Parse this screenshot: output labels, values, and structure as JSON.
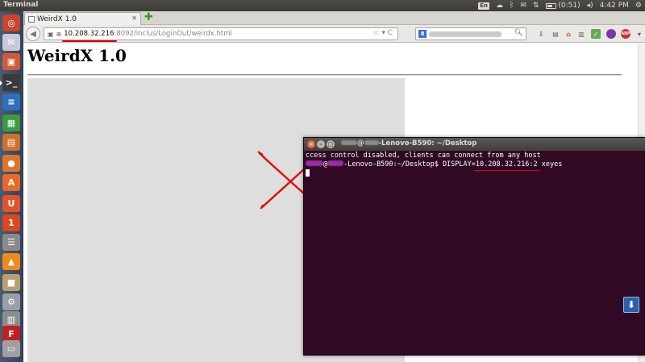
{
  "top_panel": {
    "app_title": "Terminal",
    "keyboard_layout": "En",
    "battery_time": "(0:51)",
    "clock": "4:42 PM"
  },
  "launcher": {
    "items": [
      {
        "name": "dash-home",
        "glyph": "◎",
        "color": "#c7462c"
      },
      {
        "name": "pidgin",
        "glyph": "✉",
        "color": "#c8c8d8"
      },
      {
        "name": "media-player",
        "glyph": "▣",
        "color": "#d05a3a"
      },
      {
        "name": "terminal",
        "glyph": ">_",
        "color": "#3a3a3a"
      },
      {
        "name": "libreoffice-writer",
        "glyph": "≡",
        "color": "#2f6fbf"
      },
      {
        "name": "libreoffice-calc",
        "glyph": "▦",
        "color": "#3e9a3e"
      },
      {
        "name": "libreoffice-impress",
        "glyph": "▤",
        "color": "#d0702a"
      },
      {
        "name": "firefox",
        "glyph": "●",
        "color": "#e0752a"
      },
      {
        "name": "software-center",
        "glyph": "A",
        "color": "#e8692a"
      },
      {
        "name": "ubuntu-one",
        "glyph": "U",
        "color": "#e0542a"
      },
      {
        "name": "ubuntu-one-2",
        "glyph": "1",
        "color": "#d9481f"
      },
      {
        "name": "notes-app",
        "glyph": "☰",
        "color": "#8a8a8a"
      },
      {
        "name": "vlc",
        "glyph": "▲",
        "color": "#f08a1a"
      },
      {
        "name": "archive-manager",
        "glyph": "■",
        "color": "#b8a070"
      },
      {
        "name": "system-settings",
        "glyph": "⚙",
        "color": "#9aa0a8"
      },
      {
        "name": "scripts-manager",
        "glyph": "▥",
        "color": "#8c8c8c"
      },
      {
        "name": "filezilla",
        "glyph": "F",
        "color": "#c02020"
      },
      {
        "name": "trash",
        "glyph": "▭",
        "color": "#a0a0a0"
      }
    ]
  },
  "browser": {
    "tab_title": "WeirdX 1.0",
    "url_host": "10.208.32.216",
    "url_rest": ":8092/inclus/LoginOut/weirdx.html",
    "page_heading": "WeirdX 1.0"
  },
  "terminal": {
    "title_suffix": "-Lenovo-B590: ~/Desktop",
    "line1": "ccess control disabled, clients can connect from any host",
    "prompt_suffix": "-Lenovo-B590:~/Desktop$ DISPLAY=",
    "display_value": "10.208.32.216:2",
    "command_tail": " xeyes"
  }
}
